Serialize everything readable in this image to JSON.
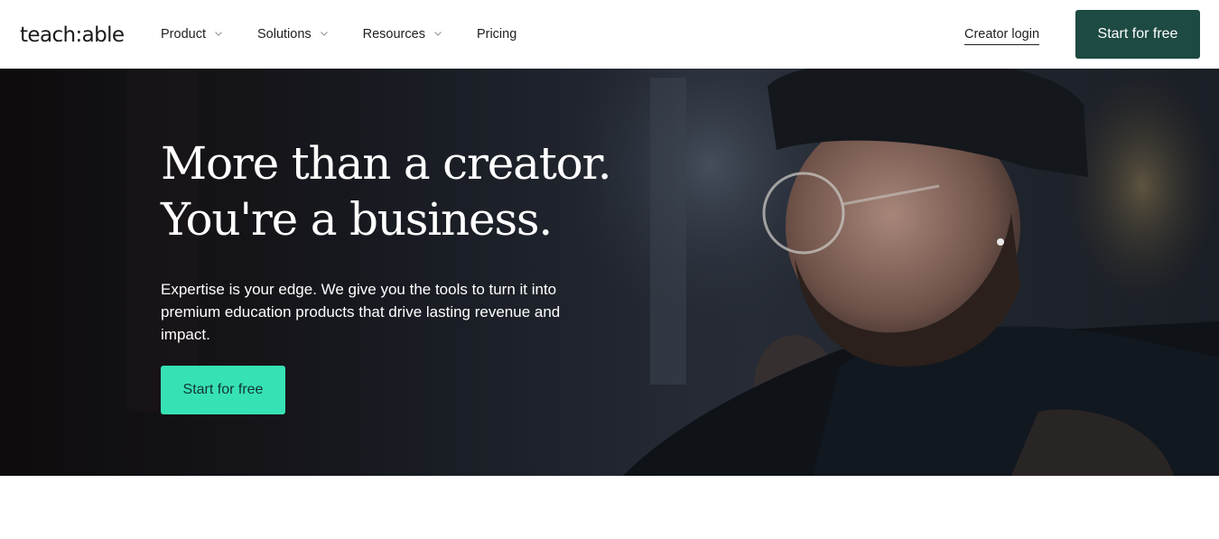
{
  "brand": {
    "logo_text": "teach:able"
  },
  "nav": {
    "items": [
      {
        "label": "Product",
        "has_dropdown": true
      },
      {
        "label": "Solutions",
        "has_dropdown": true
      },
      {
        "label": "Resources",
        "has_dropdown": true
      },
      {
        "label": "Pricing",
        "has_dropdown": false
      }
    ],
    "creator_login": "Creator login",
    "cta_label": "Start for free"
  },
  "hero": {
    "title_line1": "More than a creator.",
    "title_line2": "You're a business.",
    "subtitle": "Expertise is your edge. We give you the tools to turn it into premium education products that drive lasting revenue and impact.",
    "cta_label": "Start for free"
  },
  "colors": {
    "header_cta_bg": "#1d4a42",
    "hero_cta_bg": "#36e2b4",
    "hero_overlay": "#171a21"
  }
}
